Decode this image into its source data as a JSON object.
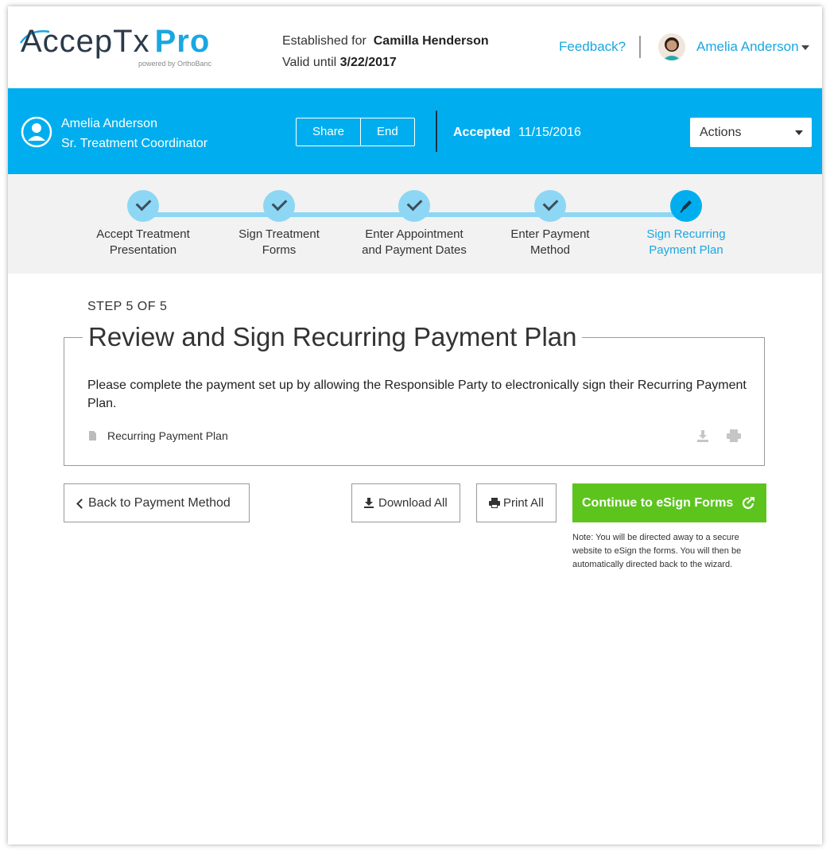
{
  "brand": {
    "name": "AccepTx",
    "pro": "Pro",
    "powered": "powered by OrthoBanc",
    "accent": "#00aeef",
    "success": "#5dc41e"
  },
  "header": {
    "established_label": "Established for",
    "established_name": "Camilla Henderson",
    "valid_label": "Valid until",
    "valid_date": "3/22/2017",
    "feedback": "Feedback?",
    "user_name": "Amelia Anderson"
  },
  "bar": {
    "person_name": "Amelia Anderson",
    "person_role": "Sr. Treatment Coordinator",
    "share": "Share",
    "end": "End",
    "status_label": "Accepted",
    "status_date": "11/15/2016",
    "actions": "Actions"
  },
  "steps": [
    {
      "line1": "Accept Treatment",
      "line2": "Presentation",
      "state": "done"
    },
    {
      "line1": "Sign Treatment",
      "line2": "Forms",
      "state": "done"
    },
    {
      "line1": "Enter Appointment",
      "line2": "and Payment Dates",
      "state": "done"
    },
    {
      "line1": "Enter Payment",
      "line2": "Method",
      "state": "done"
    },
    {
      "line1": "Sign Recurring",
      "line2": "Payment Plan",
      "state": "active"
    }
  ],
  "main": {
    "step_count": "STEP 5 OF 5",
    "title": "Review and Sign Recurring Payment Plan",
    "description": "Please complete the payment set up by allowing the Responsible Party to electronically sign their Recurring Payment Plan.",
    "document": "Recurring Payment Plan",
    "back": "Back to Payment Method",
    "download_all": "Download All",
    "print_all": "Print All",
    "continue": "Continue to eSign Forms",
    "note": "Note: You will be directed away to a secure website to eSign the forms. You will then be automatically directed back to the wizard."
  }
}
